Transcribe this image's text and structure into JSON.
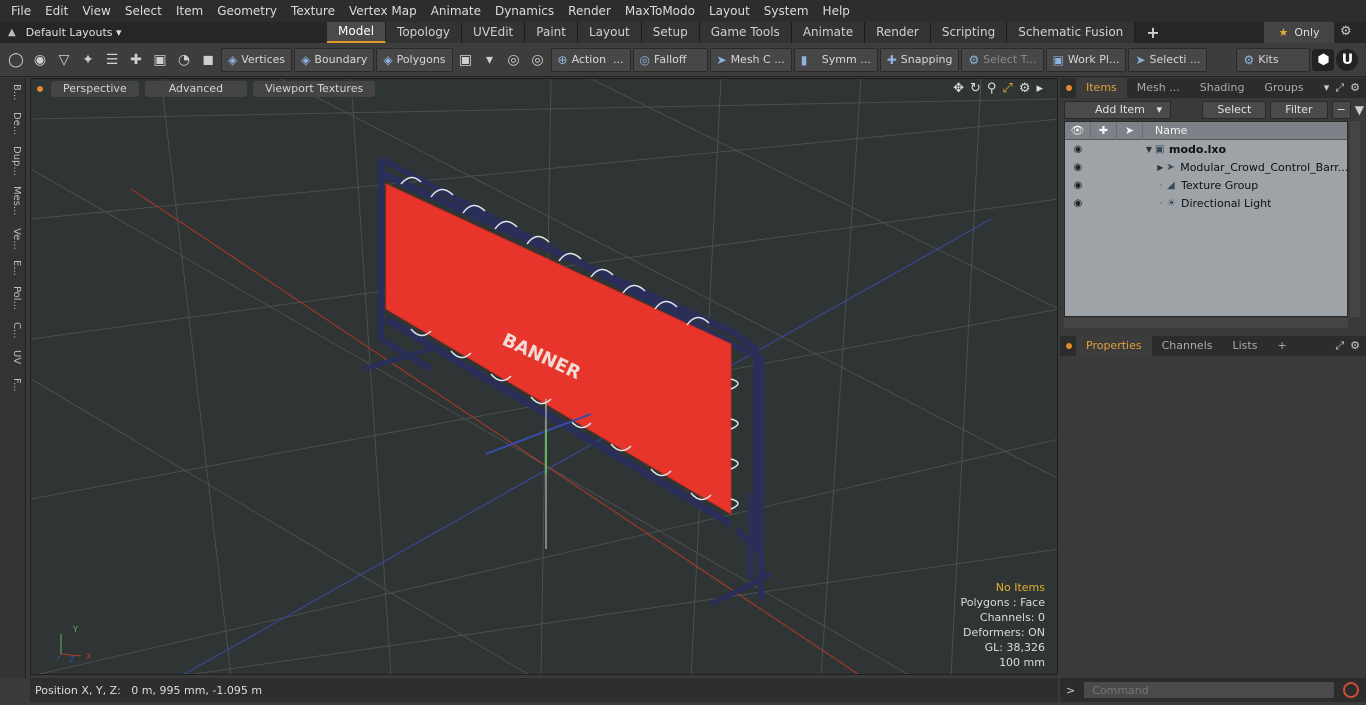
{
  "menu": [
    "File",
    "Edit",
    "View",
    "Select",
    "Item",
    "Geometry",
    "Texture",
    "Vertex Map",
    "Animate",
    "Dynamics",
    "Render",
    "MaxToModo",
    "Layout",
    "System",
    "Help"
  ],
  "layout_menu": "Default Layouts ▾",
  "tabs": [
    "Model",
    "Topology",
    "UVEdit",
    "Paint",
    "Layout",
    "Setup",
    "Game Tools",
    "Animate",
    "Render",
    "Scripting",
    "Schematic Fusion"
  ],
  "tab_plus": "+",
  "only_label": "Only",
  "toolbar": {
    "vertices": "Vertices",
    "boundary": "Boundary",
    "polygons": "Polygons",
    "action": "Action",
    "falloff": "Falloff",
    "mesh_c": "Mesh C ...",
    "symm": "Symm ...",
    "snapping": "Snapping",
    "select_t": "Select T...",
    "work_pl": "Work Pl...",
    "selecti": "Selecti ...",
    "kits": "Kits"
  },
  "left_strip": [
    "B...",
    "De...",
    "Dup...",
    "Mes...",
    "Ve...",
    "E...",
    "Pol...",
    "C...",
    "UV",
    "F..."
  ],
  "viewport": {
    "perspective": "Perspective",
    "advanced": "Advanced",
    "viewport_textures": "Viewport Textures",
    "banner_text": "BANNER",
    "axis_y": "Y",
    "axis_z": "Z",
    "axis_x": "X",
    "stats": {
      "no_items": "No Items",
      "polygons": "Polygons : Face",
      "channels": "Channels: 0",
      "deformers": "Deformers: ON",
      "gl": "GL: 38,326",
      "grid": "100 mm"
    }
  },
  "status": "Position X, Y, Z:   0 m, 995 mm, -1.095 m",
  "right_tabs": [
    "Items",
    "Mesh ...",
    "Shading",
    "Groups"
  ],
  "add_item": "Add Item",
  "select_btn": "Select",
  "filter_btn": "Filter",
  "items_header": "Name",
  "items": [
    {
      "label": "modo.lxo",
      "bold": true
    },
    {
      "label": "Modular_Crowd_Control_Barr..."
    },
    {
      "label": "Texture Group"
    },
    {
      "label": "Directional Light"
    }
  ],
  "props_tabs": [
    "Properties",
    "Channels",
    "Lists"
  ],
  "props_plus": "+",
  "command_placeholder": "Command",
  "colors": {
    "accent": "#e3a03b",
    "banner": "#e8352b",
    "frame": "#2a2f5a"
  }
}
